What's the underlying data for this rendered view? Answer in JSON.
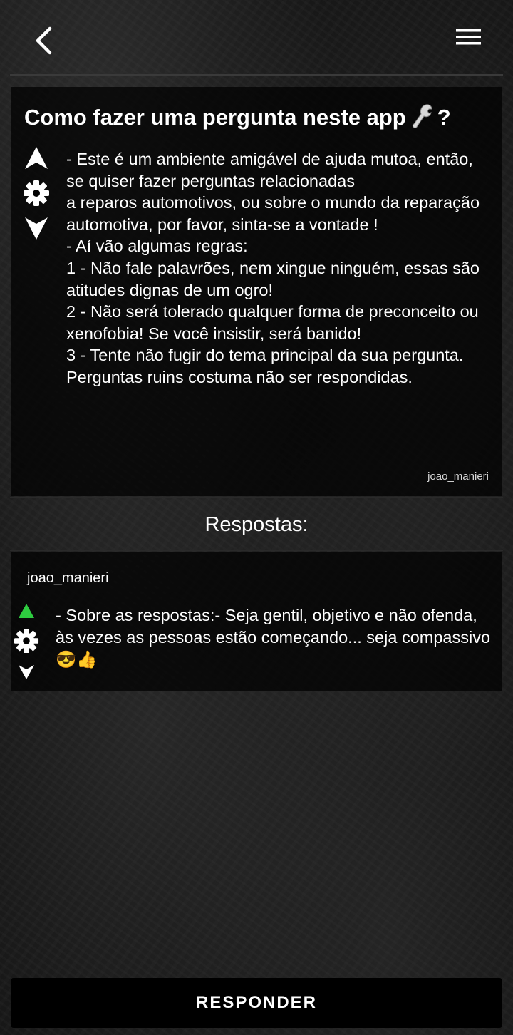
{
  "header": {
    "back_icon": "chevron-left-icon",
    "menu_icon": "hamburger-menu-icon"
  },
  "question": {
    "title": "Como fazer uma pergunta neste app",
    "title_icon": "wrench-icon",
    "title_suffix": "?",
    "body": "- Este é um ambiente amigável de ajuda mutoa, então, se quiser fazer perguntas relacionadas\na reparos automotivos, ou sobre o mundo da reparação automotiva, por favor, sinta-se a vontade !\n- Aí vão algumas regras:\n1 - Não fale palavrões, nem xingue ninguém, essas são atitudes dignas de um ogro!\n2 - Não será tolerado qualquer forma de preconceito ou xenofobia! Se você insistir, será banido!\n3 - Tente não fugir do tema principal da sua pergunta. Perguntas ruins costuma não ser respondidas.",
    "author": "joao_manieri",
    "vote_icons": [
      "upvote-arrow-icon",
      "gear-icon",
      "downvote-arrow-icon"
    ]
  },
  "answers_section": {
    "heading": "Respostas:"
  },
  "answers": [
    {
      "author": "joao_manieri",
      "body": "- Sobre as respostas:- Seja gentil, objetivo e não ofenda, às vezes as pessoas estão começando... seja compassivo 😎👍",
      "upvote_color": "#2ecc40",
      "vote_icons": [
        "upvote-arrow-icon",
        "gear-icon",
        "downvote-arrow-icon"
      ]
    }
  ],
  "footer": {
    "respond_label": "RESPONDER"
  },
  "colors": {
    "background": "#161616",
    "panel": "#000000",
    "text": "#ffffff",
    "upvote_active": "#2ecc40"
  }
}
